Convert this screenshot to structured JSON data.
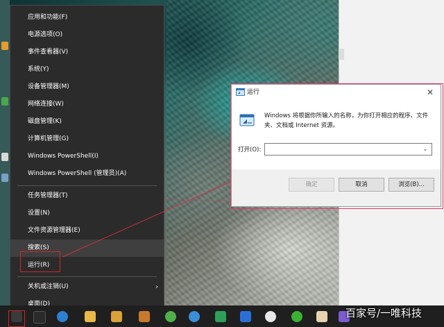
{
  "context_menu": {
    "items": [
      {
        "label": "应用和功能(F)"
      },
      {
        "label": "电源选项(O)"
      },
      {
        "label": "事件查看器(V)"
      },
      {
        "label": "系统(Y)"
      },
      {
        "label": "设备管理器(M)"
      },
      {
        "label": "网络连接(W)"
      },
      {
        "label": "磁盘管理(K)"
      },
      {
        "label": "计算机管理(G)"
      },
      {
        "label": "Windows PowerShell(I)"
      },
      {
        "label": "Windows PowerShell (管理员)(A)"
      },
      {
        "label": "任务管理器(T)"
      },
      {
        "label": "设置(N)"
      },
      {
        "label": "文件资源管理器(E)"
      },
      {
        "label": "搜索(S)"
      },
      {
        "label": "运行(R)"
      },
      {
        "label": "关机或注销(U)"
      },
      {
        "label": "桌面(D)"
      }
    ],
    "submenu_arrow": "›"
  },
  "run_dialog": {
    "title": "运行",
    "close_glyph": "✕",
    "description": "Windows 将根据你所输入的名称，为你打开相应的程序、文件夹、文档或 Internet 资源。",
    "open_label": "打开(O):",
    "open_value": "",
    "dropdown_glyph": "⌄",
    "ok_label": "确定",
    "cancel_label": "取消",
    "browse_label": "浏览(B)..."
  },
  "watermark": "百家号/一唯科技",
  "icons": {
    "run_dialog_icon": "run-program-icon",
    "menu_arrow": "chevron-right-icon",
    "taskbar": [
      "windows-start-icon",
      "search-icon",
      "ie-browser-icon",
      "folder-icon",
      "sogou-icon",
      "media-player-icon",
      "qq-icon",
      "ev-recorder-icon",
      "wechat-icon",
      "paint-icon",
      "app-icon"
    ]
  },
  "colors": {
    "menu_bg": "#2b2b2b",
    "menu_hover": "#3f3f3f",
    "highlight_red": "#d02828",
    "dialog_outline": "#e03a6a",
    "taskbar_bg": "#1f1f1f"
  }
}
